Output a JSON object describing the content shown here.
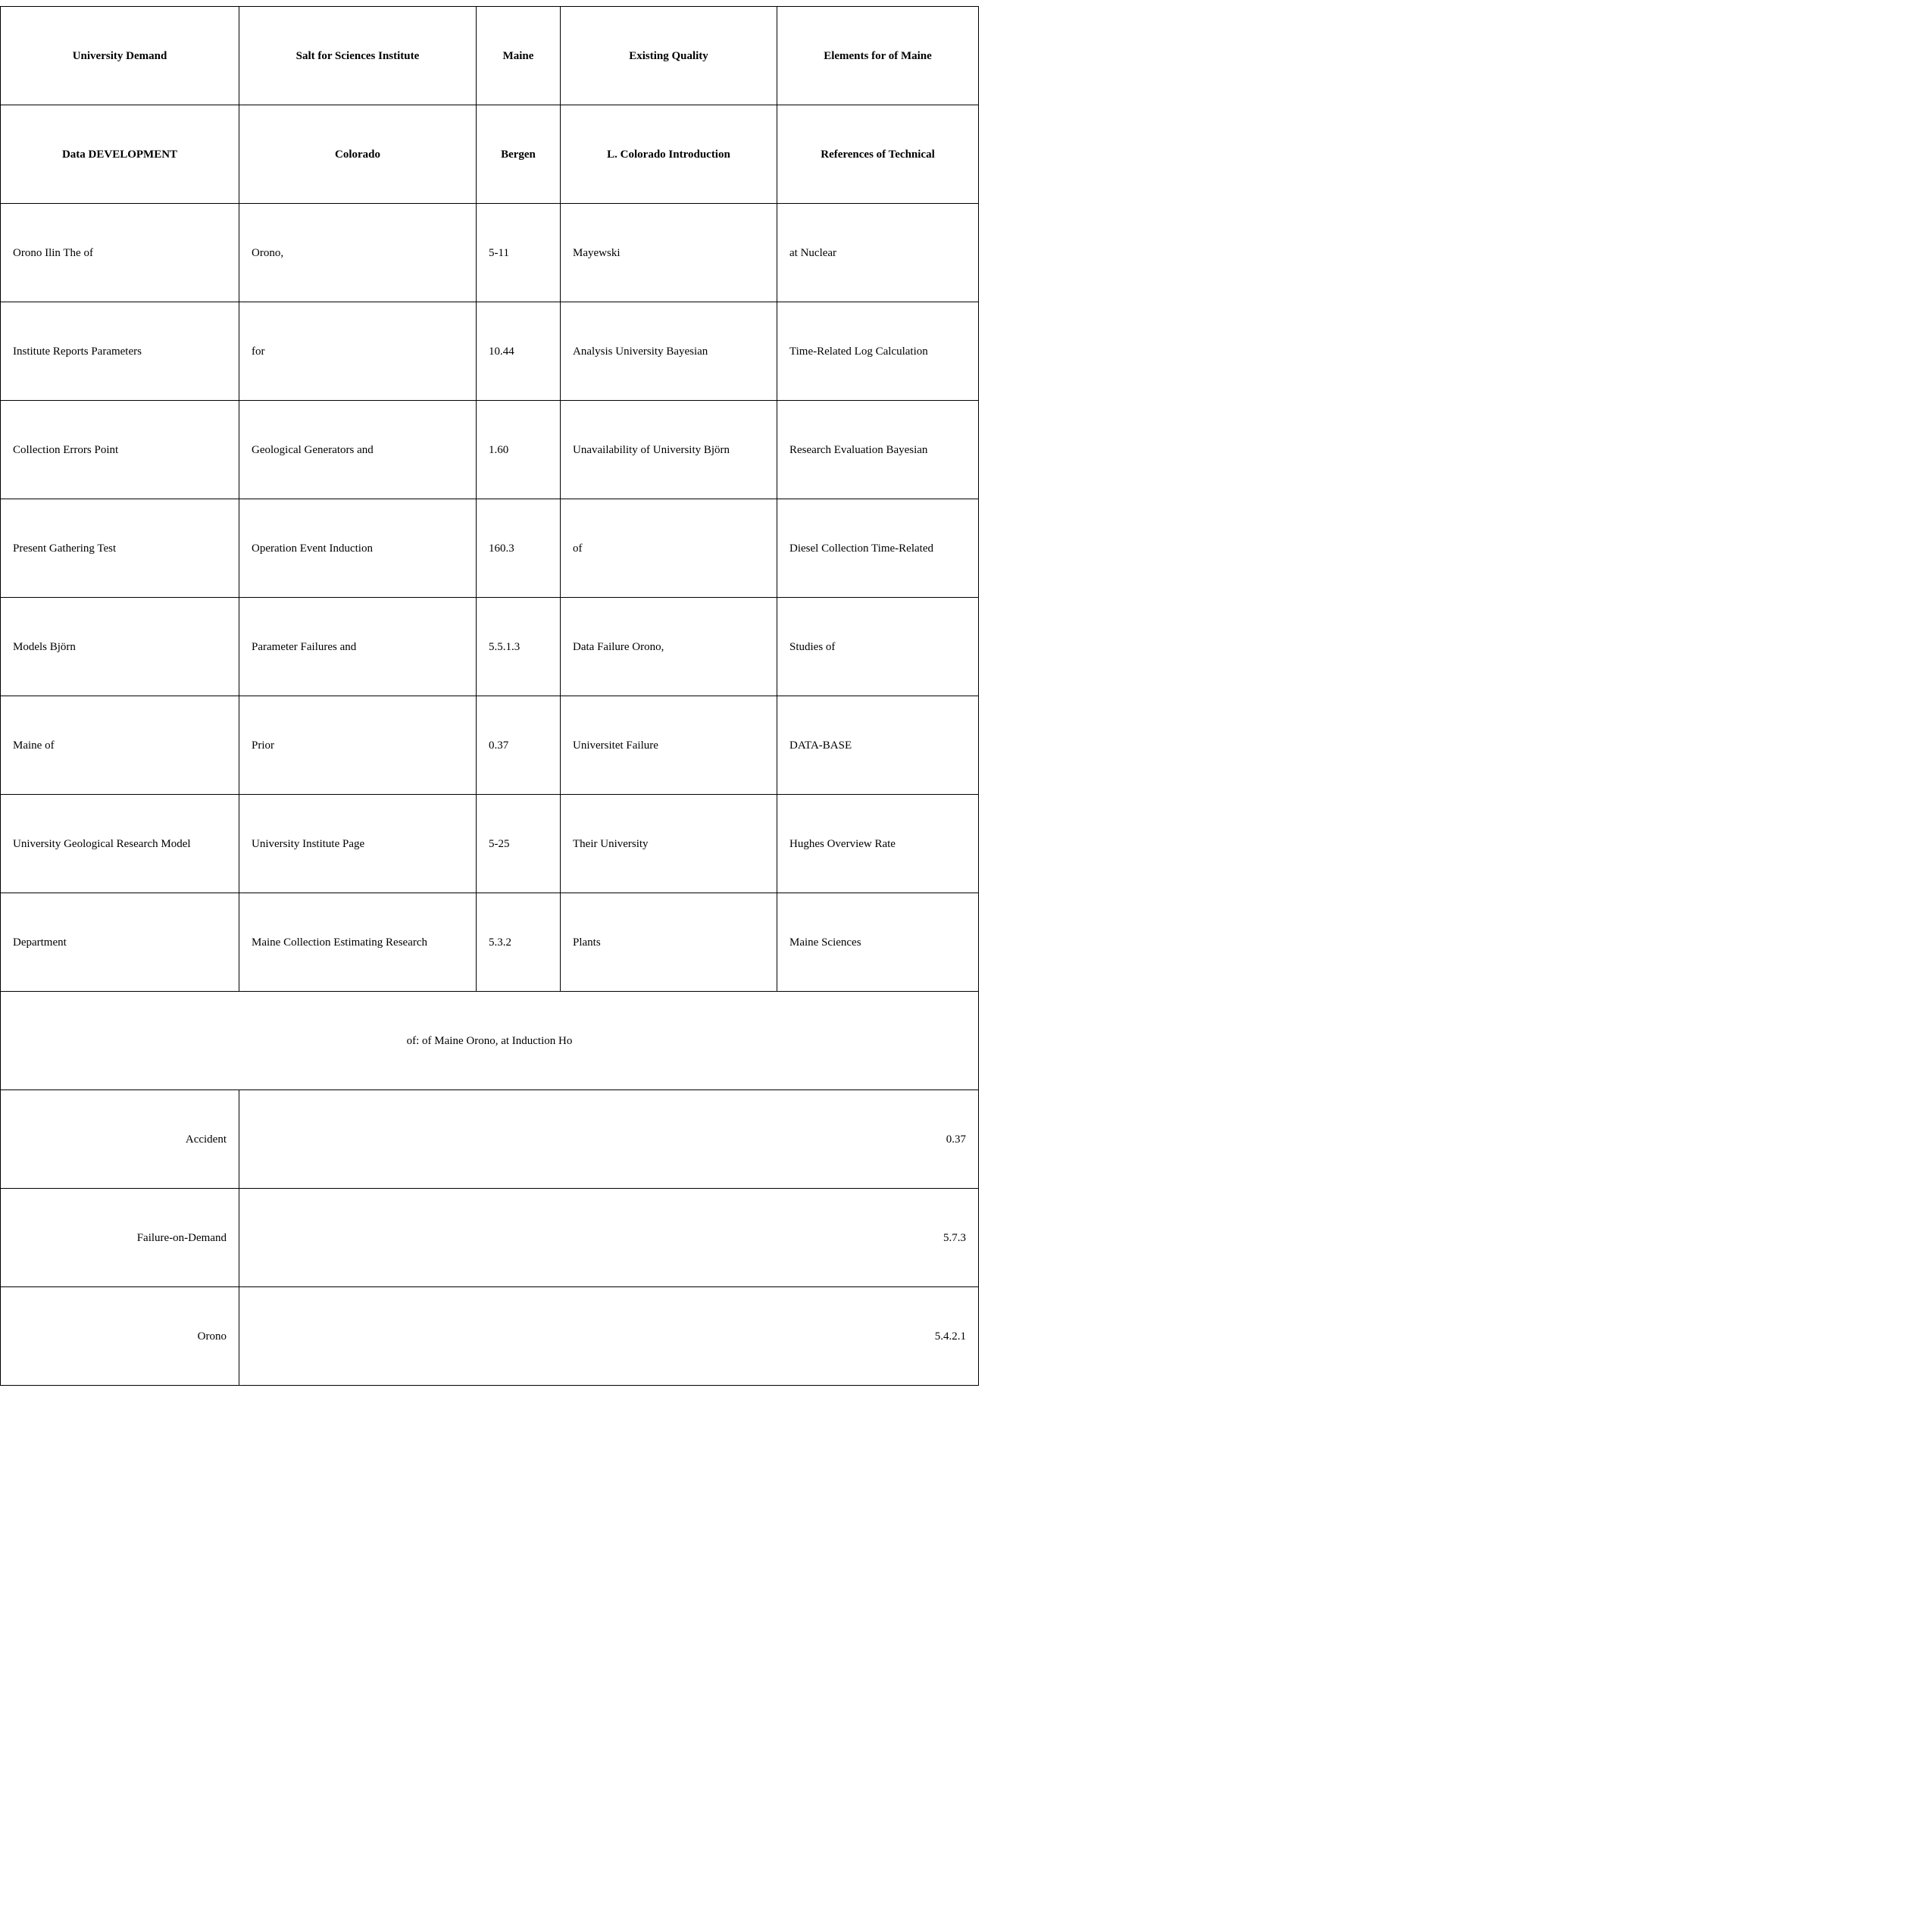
{
  "table": {
    "header_rows": [
      [
        "University Demand",
        "Salt for Sciences Institute",
        "Maine",
        "Existing Quality",
        "Elements for of Maine"
      ],
      [
        "Data DEVELOPMENT",
        "Colorado",
        "Bergen",
        "L. Colorado Introduction",
        "References of Technical"
      ]
    ],
    "rows": [
      [
        "Orono Ilin The of",
        "Orono,",
        "5-11",
        "Mayewski",
        "at Nuclear"
      ],
      [
        "Institute Reports Parameters",
        "for",
        "10.44",
        "Analysis University Bayesian",
        "Time-Related Log Calculation"
      ],
      [
        "Collection Errors Point",
        "Geological Generators and",
        "1.60",
        "Unavailability of University Björn",
        "Research Evaluation Bayesian"
      ],
      [
        "Present Gathering Test",
        "Operation Event Induction",
        "160.3",
        "of",
        "Diesel Collection Time-Related"
      ],
      [
        "Models Björn",
        "Parameter Failures and",
        "5.5.1.3",
        "Data Failure Orono,",
        "Studies of"
      ],
      [
        "Maine of",
        "Prior",
        "0.37",
        "Universitet Failure",
        "DATA-BASE"
      ],
      [
        "University Geological Research Model",
        "University Institute Page",
        "5-25",
        "Their University",
        "Hughes Overview Rate"
      ],
      [
        "Department",
        "Maine Collection Estimating Research",
        "5.3.2",
        "Plants",
        "Maine Sciences"
      ]
    ],
    "section_row": "of: of Maine Orono, at Induction Ho",
    "summary_rows": [
      {
        "label": "Accident",
        "value": "0.37"
      },
      {
        "label": "Failure-on-Demand",
        "value": "5.7.3"
      },
      {
        "label": "Orono",
        "value": "5.4.2.1"
      }
    ]
  }
}
